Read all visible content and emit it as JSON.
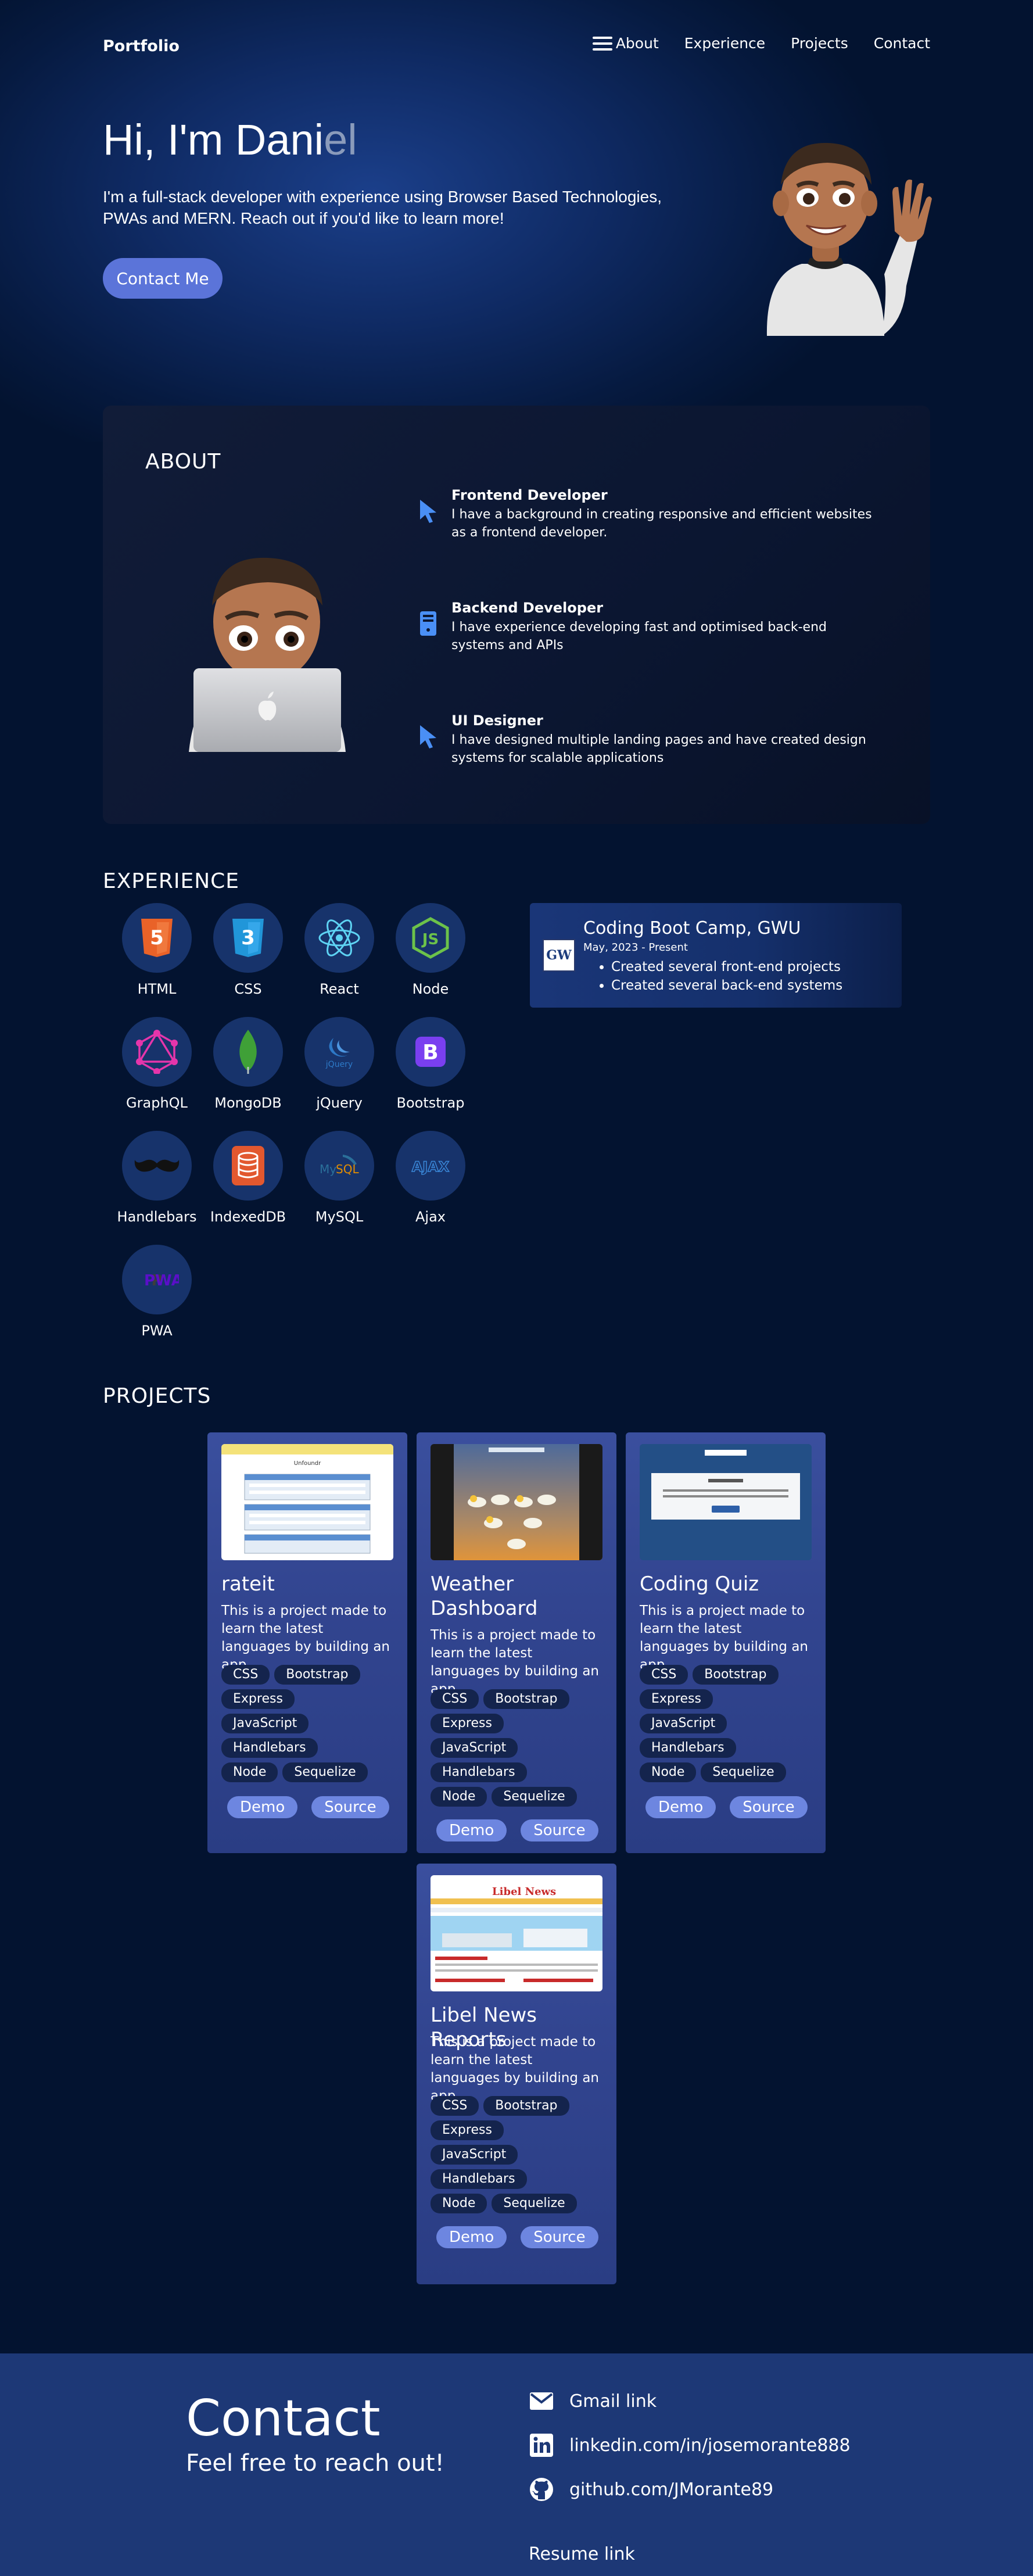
{
  "nav": {
    "logo": "Portfolio",
    "items": [
      "About",
      "Experience",
      "Projects",
      "Contact"
    ]
  },
  "hero": {
    "title_main": "Hi, I'm Dani",
    "title_fade": "el",
    "text": "I'm a full-stack developer with experience using Browser Based Technologies, PWAs and MERN. Reach out if you'd like to learn more!",
    "button": "Contact Me"
  },
  "about": {
    "title": "ABOUT",
    "items": [
      {
        "title": "Frontend Developer",
        "text": "I have a background in creating responsive and efficient websites as a frontend developer.",
        "icon": "cursor-icon"
      },
      {
        "title": "Backend Developer",
        "text": "I have experience developing fast and optimised back-end systems and APIs",
        "icon": "server-icon"
      },
      {
        "title": "UI Designer",
        "text": "I have designed multiple landing pages and have created design systems for scalable applications",
        "icon": "cursor-icon"
      }
    ]
  },
  "experience": {
    "title": "EXPERIENCE",
    "skills": [
      "HTML",
      "CSS",
      "React",
      "Node",
      "GraphQL",
      "MongoDB",
      "jQuery",
      "Bootstrap",
      "Handlebars",
      "IndexedDB",
      "MySQL",
      "Ajax",
      "PWA"
    ],
    "job": {
      "logo": "GW",
      "title": "Coding Boot Camp, GWU",
      "date": "May, 2023 - Present",
      "points": [
        "Created several front-end projects",
        "Created several back-end systems"
      ]
    }
  },
  "projects": {
    "title": "PROJECTS",
    "items": [
      {
        "name": "rateit",
        "desc": "This is a project made to learn the latest languages by building an app.",
        "tags": [
          "CSS",
          "Bootstrap",
          "Express",
          "JavaScript",
          "Handlebars",
          "Node",
          "Sequelize"
        ],
        "demo": "Demo",
        "source": "Source"
      },
      {
        "name": "Weather Dashboard",
        "desc": "This is a project made to learn the latest languages by building an app.",
        "tags": [
          "CSS",
          "Bootstrap",
          "Express",
          "JavaScript",
          "Handlebars",
          "Node",
          "Sequelize"
        ],
        "demo": "Demo",
        "source": "Source"
      },
      {
        "name": "Coding Quiz",
        "desc": "This is a project made to learn the latest languages by building an app.",
        "tags": [
          "CSS",
          "Bootstrap",
          "Express",
          "JavaScript",
          "Handlebars",
          "Node",
          "Sequelize"
        ],
        "demo": "Demo",
        "source": "Source"
      },
      {
        "name": "Libel News Reports",
        "desc": "This is a project made to learn the latest languages by building an app.",
        "tags": [
          "CSS",
          "Bootstrap",
          "Express",
          "JavaScript",
          "Handlebars",
          "Node",
          "Sequelize"
        ],
        "demo": "Demo",
        "source": "Source"
      }
    ],
    "shot_text": {
      "rateit": "Unfoundr",
      "libel": "Libel News"
    }
  },
  "contact": {
    "title": "Contact",
    "subtitle": "Feel free to reach out!",
    "links": [
      "Gmail link",
      "linkedin.com/in/josemorante888",
      "github.com/JMorante89"
    ],
    "resume": "Resume link"
  }
}
